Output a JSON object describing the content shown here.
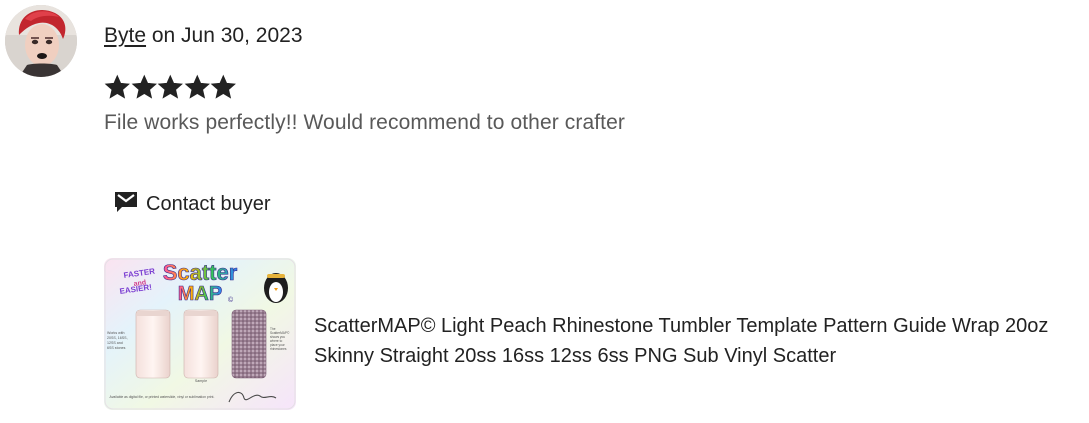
{
  "review": {
    "reviewer_name": "Byte",
    "date_text": " on Jun 30, 2023",
    "rating": 5,
    "rating_max": 5,
    "text": "File works perfectly!! Would recommend to other crafter",
    "contact_label": "Contact buyer"
  },
  "listing": {
    "title": "ScatterMAP© Light Peach Rhinestone Tumbler Template Pattern Guide Wrap 20oz Skinny Straight 20ss 16ss 12ss 6ss PNG Sub Vinyl Scatter",
    "thumbnail_text": {
      "badge_line1": "FASTER",
      "badge_line2": "and",
      "badge_line3": "EASIER!",
      "title_line1": "Scatter",
      "title_line2": "MAP",
      "title_mark": "©",
      "left_note": "Works with 20SS, 16SS, 12SS and 6SS stones",
      "right_note": "The ScatterMAP© shows you where to place your rhinestones for best fit and least fill",
      "caption_1": "ScatterMAP© applied as a sticker & light Peach rinse",
      "caption_2": "Sample",
      "caption_3": "Rhinestones applied to actual finished rhinestone result",
      "footer": "Available as digital file, or printed waterslide, vinyl or sublimation print."
    }
  },
  "icons": {
    "star": "star-icon",
    "contact": "mail-icon"
  },
  "colors": {
    "star": "#222222",
    "text_secondary": "#595959"
  }
}
